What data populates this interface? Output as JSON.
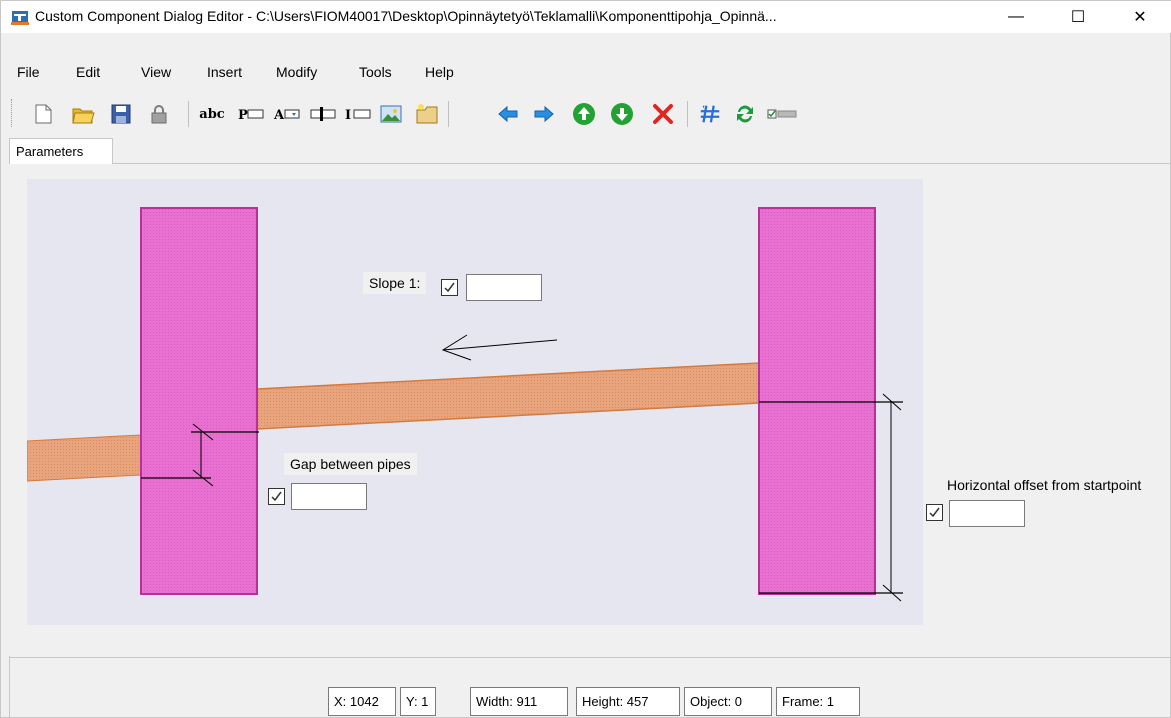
{
  "window": {
    "title": "Custom Component Dialog Editor - C:\\Users\\FIOM40017\\Desktop\\Opinnäytetyö\\Teklamalli\\Komponenttipohja_Opinnä...",
    "minimize_label": "—",
    "maximize_label": "☐",
    "close_label": "✕"
  },
  "menu": {
    "file": "File",
    "edit": "Edit",
    "view": "View",
    "insert": "Insert",
    "modify": "Modify",
    "tools": "Tools",
    "help": "Help"
  },
  "toolbar": {
    "abc": "abc",
    "p": "P",
    "a": "A",
    "i": "I"
  },
  "tabs": {
    "parameters": "Parameters"
  },
  "labels": {
    "slope": "Slope 1:",
    "gap": "Gap between pipes",
    "horizontal_offset": "Horizontal offset from startpoint"
  },
  "inputs": {
    "slope_value": "",
    "gap_value": "",
    "horizontal_offset_value": ""
  },
  "status": {
    "x": "X: 1042",
    "y": "Y: 1",
    "width": "Width: 911",
    "height": "Height: 457",
    "object": "Object: 0",
    "frame": "Frame: 1"
  },
  "colors": {
    "column": "#e86fcf",
    "pipe": "#e8a27a",
    "canvas": "#e6e6f0"
  }
}
